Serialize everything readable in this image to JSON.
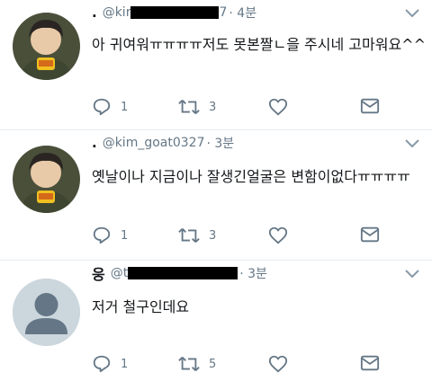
{
  "tweets": [
    {
      "display_name": ".",
      "handle_prefix": "@kir",
      "handle_suffix": "7",
      "time": "· 4분",
      "text": "아 귀여워ㅠㅠㅠㅠ저도 못본짤ㄴ을 주시네 고마워요^^",
      "reply_count": "1",
      "retweet_count": "3",
      "like_count": "",
      "avatar": "profile-photo-person-icon"
    },
    {
      "display_name": ".",
      "handle_prefix": "@kim_goat0327",
      "handle_suffix": "",
      "time": "· 3분",
      "text": "옛날이나 지금이나 잘생긴얼굴은 변함이없다ㅠㅠㅠㅠ",
      "reply_count": "1",
      "retweet_count": "3",
      "like_count": "",
      "avatar": "profile-photo-person-icon"
    },
    {
      "display_name": "웅",
      "handle_prefix": "@t",
      "handle_suffix": "",
      "time": "· 3분",
      "text": "저거 철구인데요",
      "reply_count": "1",
      "retweet_count": "5",
      "like_count": "",
      "avatar": "default-avatar-icon"
    }
  ],
  "colors": {
    "text": "#14171a",
    "secondary": "#657786",
    "divider": "#e6ecf0",
    "default_avatar_bg": "#ccd6dd"
  }
}
